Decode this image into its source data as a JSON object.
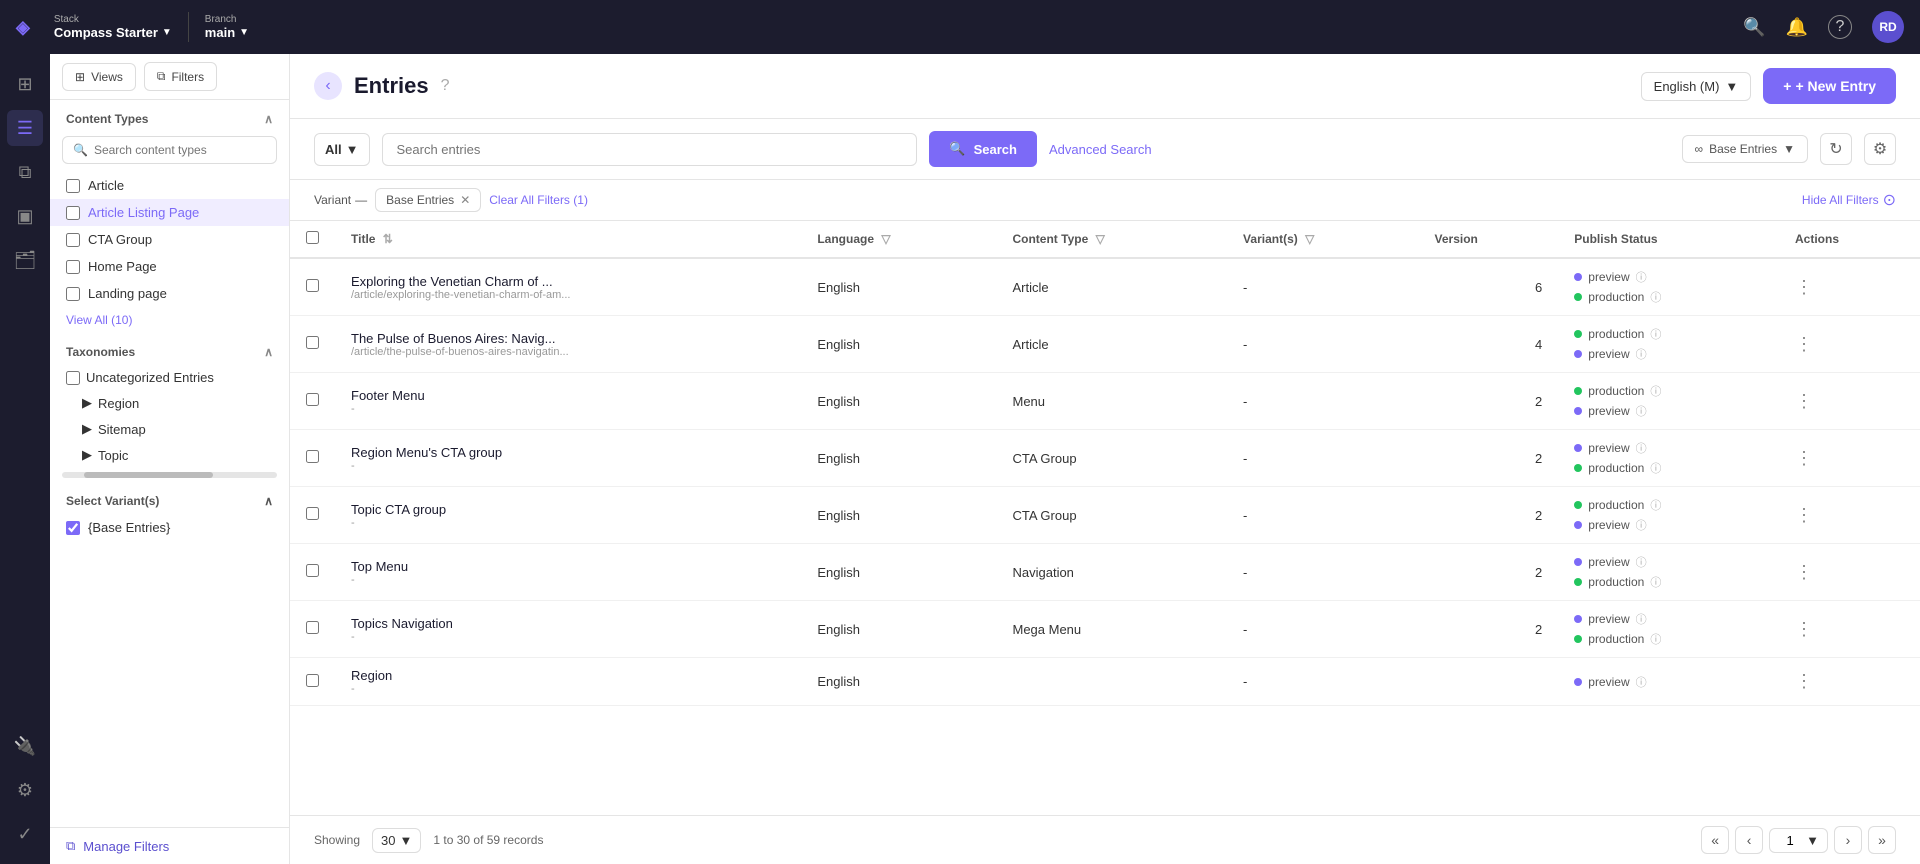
{
  "app": {
    "logo": "◈",
    "stack_label": "Stack",
    "stack_name": "Compass Starter",
    "branch_label": "Branch",
    "branch_name": "main"
  },
  "topnav": {
    "search_icon": "🔍",
    "bell_icon": "🔔",
    "help_icon": "?",
    "avatar": "RD"
  },
  "sidebar": {
    "views_btn": "Views",
    "filters_btn": "Filters",
    "content_types_label": "Content Types",
    "search_placeholder": "Search content types",
    "items": [
      {
        "label": "Article"
      },
      {
        "label": "Article Listing Page"
      },
      {
        "label": "CTA Group"
      },
      {
        "label": "Home Page"
      },
      {
        "label": "Landing page"
      }
    ],
    "view_all": "View All (10)",
    "taxonomies_label": "Taxonomies",
    "uncategorized_label": "Uncategorized Entries",
    "taxonomy_children": [
      {
        "label": "Region"
      },
      {
        "label": "Sitemap"
      },
      {
        "label": "Topic"
      }
    ],
    "select_variant_label": "Select Variant(s)",
    "variant_option": "{Base Entries}",
    "manage_filters": "Manage Filters"
  },
  "entries": {
    "title": "Entries",
    "language_selector": "English (M)",
    "new_entry_btn": "+ New Entry",
    "search_placeholder": "Search entries",
    "all_label": "All",
    "search_btn": "Search",
    "advanced_search": "Advanced Search",
    "base_entries_label": "∞ Base Entries",
    "filter_variant_label": "Variant",
    "filter_base_entries": "Base Entries",
    "clear_filters": "Clear All Filters (1)",
    "hide_filters": "Hide All Filters",
    "showing_label": "Showing",
    "per_page": "30",
    "records_info": "1 to 30 of 59 records",
    "page_number": "1"
  },
  "table": {
    "columns": [
      "Title",
      "Language",
      "Content Type",
      "Variant(s)",
      "Version",
      "Publish Status",
      "Actions"
    ],
    "rows": [
      {
        "title": "Exploring the Venetian Charm of ...",
        "title_url": "/article/exploring-the-venetian-charm-of-am...",
        "language": "English",
        "content_type": "Article",
        "variants": "-",
        "version": "6",
        "publish_statuses": [
          {
            "label": "preview",
            "type": "preview"
          },
          {
            "label": "production",
            "type": "production"
          }
        ]
      },
      {
        "title": "The Pulse of Buenos Aires: Navig...",
        "title_url": "/article/the-pulse-of-buenos-aires-navigatin...",
        "language": "English",
        "content_type": "Article",
        "variants": "-",
        "version": "4",
        "publish_statuses": [
          {
            "label": "production",
            "type": "production"
          },
          {
            "label": "preview",
            "type": "preview"
          }
        ]
      },
      {
        "title": "Footer Menu",
        "title_url": "-",
        "language": "English",
        "content_type": "Menu",
        "variants": "-",
        "version": "2",
        "publish_statuses": [
          {
            "label": "production",
            "type": "production"
          },
          {
            "label": "preview",
            "type": "preview"
          }
        ]
      },
      {
        "title": "Region Menu's CTA group",
        "title_url": "-",
        "language": "English",
        "content_type": "CTA Group",
        "variants": "-",
        "version": "2",
        "publish_statuses": [
          {
            "label": "preview",
            "type": "preview"
          },
          {
            "label": "production",
            "type": "production"
          }
        ]
      },
      {
        "title": "Topic CTA group",
        "title_url": "-",
        "language": "English",
        "content_type": "CTA Group",
        "variants": "-",
        "version": "2",
        "publish_statuses": [
          {
            "label": "production",
            "type": "production"
          },
          {
            "label": "preview",
            "type": "preview"
          }
        ]
      },
      {
        "title": "Top Menu",
        "title_url": "-",
        "language": "English",
        "content_type": "Navigation",
        "variants": "-",
        "version": "2",
        "publish_statuses": [
          {
            "label": "preview",
            "type": "preview"
          },
          {
            "label": "production",
            "type": "production"
          }
        ]
      },
      {
        "title": "Topics Navigation",
        "title_url": "-",
        "language": "English",
        "content_type": "Mega Menu",
        "variants": "-",
        "version": "2",
        "publish_statuses": [
          {
            "label": "preview",
            "type": "preview"
          },
          {
            "label": "production",
            "type": "production"
          }
        ]
      },
      {
        "title": "Region",
        "title_url": "-",
        "language": "English",
        "content_type": "",
        "variants": "-",
        "version": "",
        "publish_statuses": [
          {
            "label": "preview",
            "type": "preview"
          }
        ]
      }
    ]
  }
}
